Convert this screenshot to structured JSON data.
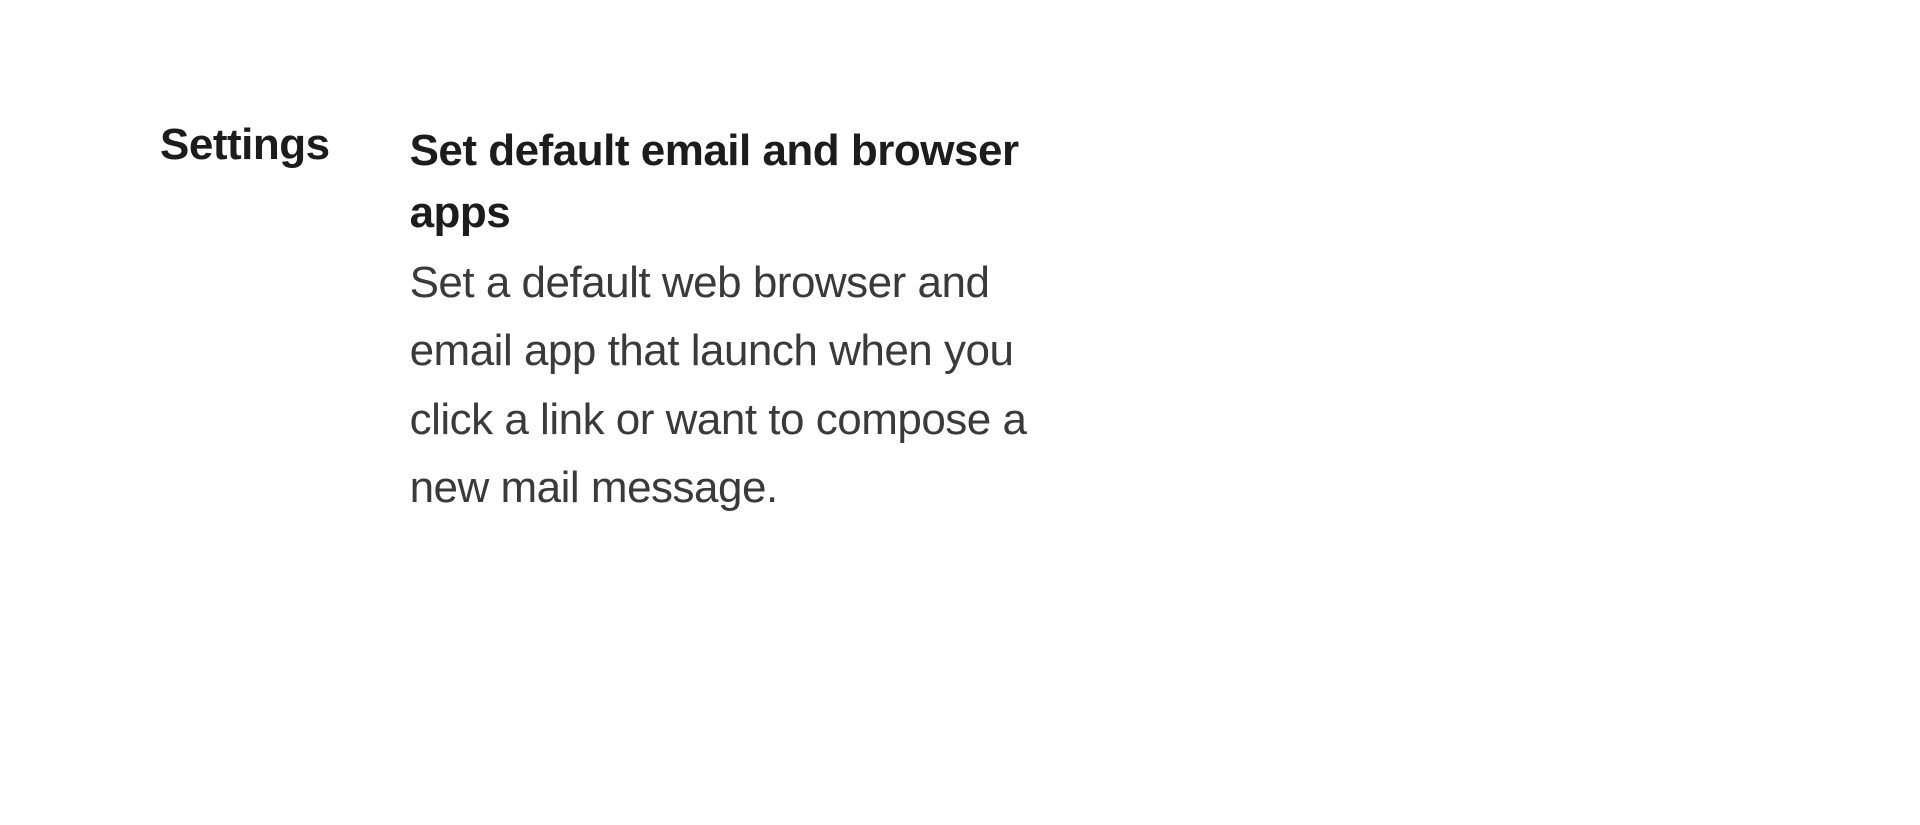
{
  "settings": {
    "category_label": "Settings",
    "section_title": "Set default email and browser apps",
    "section_description": "Set a default web browser and email app that launch when you click a link or want to compose a new mail message."
  }
}
